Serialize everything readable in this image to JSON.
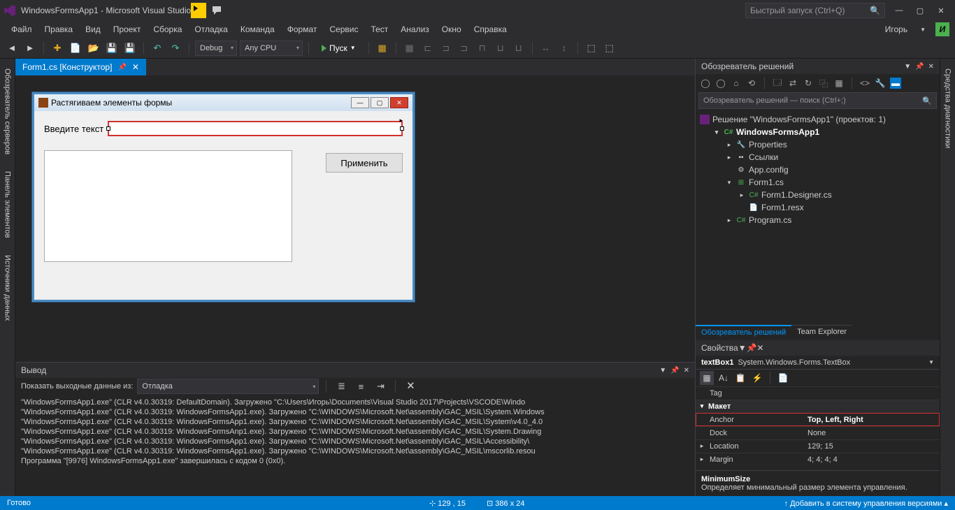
{
  "titlebar": {
    "title": "WindowsFormsApp1 - Microsoft Visual Studio",
    "search_placeholder": "Быстрый запуск (Ctrl+Q)",
    "user_name": "Игорь",
    "user_initial": "И"
  },
  "menu": {
    "items": [
      "Файл",
      "Правка",
      "Вид",
      "Проект",
      "Сборка",
      "Отладка",
      "Команда",
      "Формат",
      "Сервис",
      "Тест",
      "Анализ",
      "Окно",
      "Справка"
    ]
  },
  "toolbar": {
    "config": "Debug",
    "platform": "Any CPU",
    "start": "Пуск"
  },
  "left_rail": [
    "Обозреватель серверов",
    "Панель элементов",
    "Источники данных"
  ],
  "right_rail": [
    "Средства диагностики"
  ],
  "tab": {
    "name": "Form1.cs [Конструктор]"
  },
  "form": {
    "title": "Растягиваем элементы формы",
    "label": "Введите текст",
    "apply": "Применить"
  },
  "output": {
    "title": "Вывод",
    "show_from_label": "Показать выходные данные из:",
    "show_from_value": "Отладка",
    "lines": [
      "\"WindowsFormsApp1.exe\" (CLR v4.0.30319: DefaultDomain). Загружено \"C:\\Users\\Игорь\\Documents\\Visual Studio 2017\\Projects\\VSCODE\\Windo",
      "\"WindowsFormsApp1.exe\" (CLR v4.0.30319: WindowsFormsApp1.exe). Загружено \"C:\\WINDOWS\\Microsoft.Net\\assembly\\GAC_MSIL\\System.Windows",
      "\"WindowsFormsApp1.exe\" (CLR v4.0.30319: WindowsFormsApp1.exe). Загружено \"C:\\WINDOWS\\Microsoft.Net\\assembly\\GAC_MSIL\\System\\v4.0_4.0",
      "\"WindowsFormsApp1.exe\" (CLR v4.0.30319: WindowsFormsAnp1.exe). Загружено \"C:\\WINDOWS\\Microsoft.Net\\assembly\\GAC_MSIL\\System.Drawing",
      "\"WindowsFormsApp1.exe\" (CLR v4.0.30319: WindowsFormsApp1.exe). Загружено \"C:\\WINDOWS\\Microsoft.Net\\assembly\\GAC_MSIL\\Accessibility\\",
      "\"WindowsFormsApp1.exe\" (CLR v4.0.30319: WindowsFormsApp1.exe). Загружено \"C:\\WINDOWS\\Microsoft.Net\\assembly\\GAC_MSIL\\mscorlib.resou",
      "Программа \"[9976] WindowsFormsApp1.exe\" завершилась с кодом 0 (0x0)."
    ]
  },
  "solution_explorer": {
    "title": "Обозреватель решений",
    "search_placeholder": "Обозреватель решений — поиск (Ctrl+;)",
    "solution": "Решение \"WindowsFormsApp1\"  (проектов: 1)",
    "project": "WindowsFormsApp1",
    "nodes": {
      "properties": "Properties",
      "refs": "Ссылки",
      "appconfig": "App.config",
      "form1": "Form1.cs",
      "designer": "Form1.Designer.cs",
      "resx": "Form1.resx",
      "program": "Program.cs"
    },
    "tabs": [
      "Обозреватель решений",
      "Team Explorer"
    ]
  },
  "properties": {
    "title": "Свойства",
    "object_name": "textBox1",
    "object_type": "System.Windows.Forms.TextBox",
    "rows": [
      {
        "k": "Tag",
        "v": "",
        "exp": ""
      },
      {
        "k": "Макет",
        "v": "",
        "cat": true,
        "exp": "▾"
      },
      {
        "k": "Anchor",
        "v": "Top, Left, Right",
        "hl": true,
        "exp": ""
      },
      {
        "k": "Dock",
        "v": "None",
        "exp": ""
      },
      {
        "k": "Location",
        "v": "129; 15",
        "exp": "▸"
      },
      {
        "k": "Margin",
        "v": "4; 4; 4; 4",
        "exp": "▸"
      }
    ],
    "desc_name": "MinimumSize",
    "desc_text": "Определяет минимальный размер элемента управления."
  },
  "status": {
    "ready": "Готово",
    "pos": "129 , 15",
    "size": "386 x 24",
    "vcs": "Добавить в систему управления версиями"
  }
}
